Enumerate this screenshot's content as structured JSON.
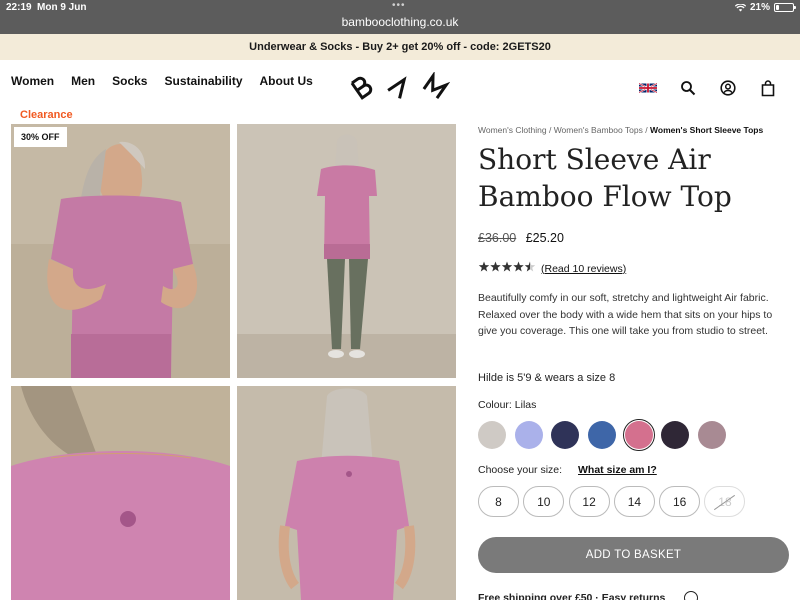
{
  "status_bar": {
    "time": "22:19",
    "date": "Mon 9 Jun",
    "battery": "21%",
    "battery_level": 0.21,
    "url": "bambooclothing.co.uk"
  },
  "promo": {
    "text": "Underwear & Socks - Buy 2+ get 20% off - code: 2GETS20"
  },
  "nav": {
    "items": [
      "Women",
      "Men",
      "Socks",
      "Sustainability",
      "About Us"
    ]
  },
  "logo": {
    "icon": "bam-logo"
  },
  "header_icons": [
    "uk-flag-icon",
    "search-icon",
    "account-icon",
    "basket-icon"
  ],
  "gallery": {
    "clearance_label": "Clearance",
    "discount_badge": "30% OFF"
  },
  "breadcrumb": {
    "items": [
      "Women's Clothing",
      "Women's Bamboo Tops"
    ],
    "separator": "/",
    "current": "Women's Short Sleeve Tops"
  },
  "product": {
    "title": "Short Sleeve Air Bamboo Flow Top",
    "price_old": "£36.00",
    "price_new": "£25.20",
    "rating": 4.5,
    "reviews_link": "(Read 10 reviews)",
    "description": "Beautifully comfy in our soft, stretchy and lightweight Air fabric. Relaxed over the body with a wide hem that sits on your hips to give you coverage. This one will take you from studio to street.",
    "model_info": "Hilde is 5'9 & wears a size 8",
    "colour_label": "Colour: Lilas",
    "colours": [
      {
        "hex": "#cfcac5",
        "selected": false
      },
      {
        "hex": "#aab1ea",
        "selected": false
      },
      {
        "hex": "#2f3358",
        "selected": false
      },
      {
        "hex": "#3e66a8",
        "selected": false
      },
      {
        "hex": "#d4708e",
        "selected": true
      },
      {
        "hex": "#2f2736",
        "selected": false
      },
      {
        "hex": "#a88a93",
        "selected": false
      }
    ],
    "size_label": "Choose your size:",
    "size_guide": "What size am I?",
    "sizes": [
      {
        "label": "8",
        "available": true
      },
      {
        "label": "10",
        "available": true
      },
      {
        "label": "12",
        "available": true
      },
      {
        "label": "14",
        "available": true
      },
      {
        "label": "16",
        "available": true
      },
      {
        "label": "18",
        "available": false
      }
    ],
    "add_to_basket": "ADD TO BASKET",
    "free_shipping": "Free shipping over £50 · Easy returns"
  }
}
